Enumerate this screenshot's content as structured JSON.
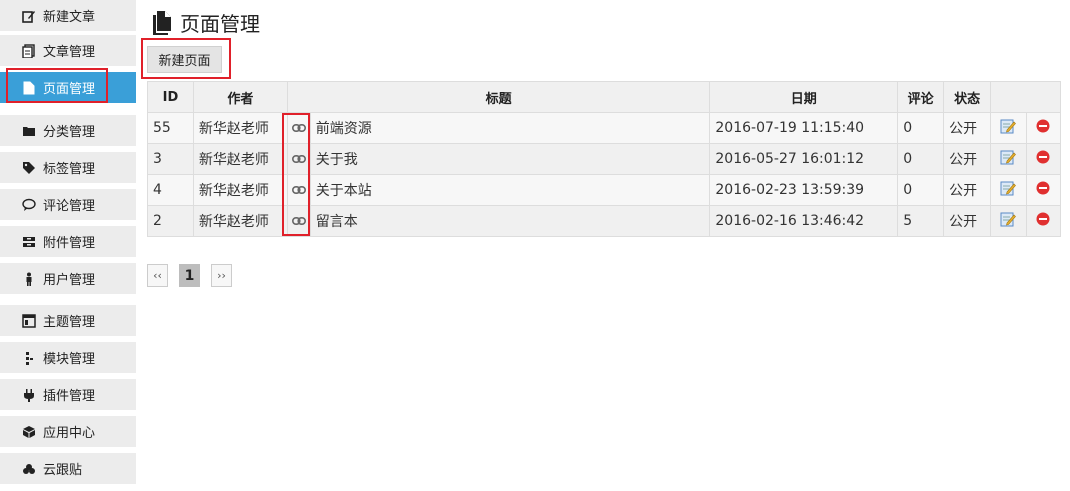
{
  "sidebar": {
    "items": [
      {
        "label": "新建文章",
        "icon": "edit-icon"
      },
      {
        "label": "文章管理",
        "icon": "documents-icon"
      },
      {
        "label": "页面管理",
        "icon": "file-icon",
        "active": true
      },
      {
        "label": "分类管理",
        "icon": "folder-icon"
      },
      {
        "label": "标签管理",
        "icon": "tag-icon"
      },
      {
        "label": "评论管理",
        "icon": "comment-icon"
      },
      {
        "label": "附件管理",
        "icon": "archive-icon"
      },
      {
        "label": "用户管理",
        "icon": "user-icon"
      },
      {
        "label": "主题管理",
        "icon": "theme-icon"
      },
      {
        "label": "模块管理",
        "icon": "module-icon"
      },
      {
        "label": "插件管理",
        "icon": "plugin-icon"
      },
      {
        "label": "应用中心",
        "icon": "cube-icon"
      },
      {
        "label": "云跟贴",
        "icon": "cloud-icon"
      }
    ]
  },
  "header": {
    "title": "页面管理",
    "icon": "file-icon"
  },
  "toolbar": {
    "new_page_label": "新建页面"
  },
  "table": {
    "headers": {
      "id": "ID",
      "author": "作者",
      "title": "标题",
      "date": "日期",
      "comments": "评论",
      "status": "状态"
    },
    "rows": [
      {
        "id": "55",
        "author": "新华赵老师",
        "title": "前端资源",
        "date": "2016-07-19 11:15:40",
        "comments": "0",
        "status": "公开"
      },
      {
        "id": "3",
        "author": "新华赵老师",
        "title": "关于我",
        "date": "2016-05-27 16:01:12",
        "comments": "0",
        "status": "公开"
      },
      {
        "id": "4",
        "author": "新华赵老师",
        "title": "关于本站",
        "date": "2016-02-23 13:59:39",
        "comments": "0",
        "status": "公开"
      },
      {
        "id": "2",
        "author": "新华赵老师",
        "title": "留言本",
        "date": "2016-02-16 13:46:42",
        "comments": "5",
        "status": "公开"
      }
    ]
  },
  "pagination": {
    "prev": "‹‹",
    "current": "1",
    "next": "››"
  },
  "colors": {
    "accent": "#3a9fd8",
    "highlight": "#e0202a",
    "delete": "#e03030"
  }
}
